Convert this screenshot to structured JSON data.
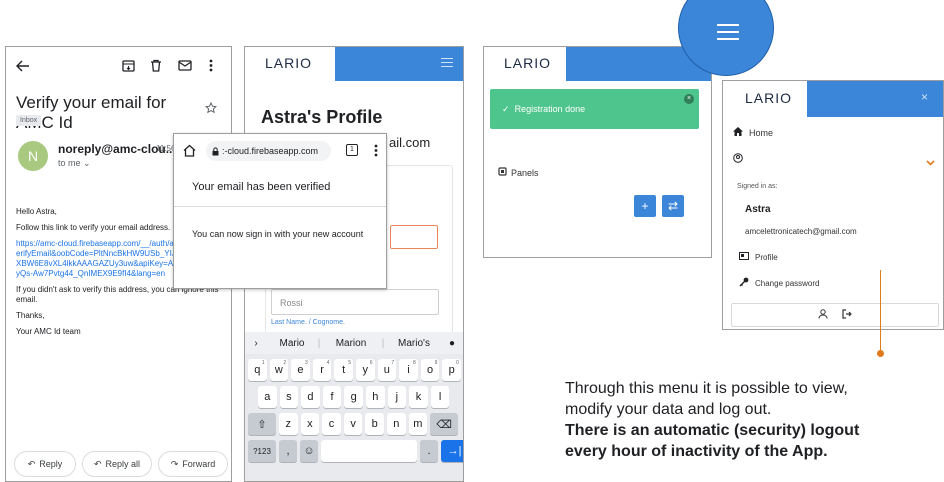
{
  "email": {
    "subject": "Verify your email for AMC Id",
    "label_chip": "Inbox",
    "avatar_letter": "N",
    "sender": "noreply@amc-clou...",
    "time": "11:56",
    "to": "to me",
    "greeting": "Hello Astra,",
    "line1": "Follow this link to verify your email address.",
    "link": "https://amc-cloud.firebaseapp.com/__/auth/action?mode=verifyEmail&oobCode=PltNncBkHW9USb_YIJ1S8s5YTVWj_XBW6E8vXL4lkkAAAGAZUy3uw&apiKey=AIzaSyBjpgh0QyQs-Aw7Pvtg44_QnIMEX9E9fI4&lang=en",
    "line2": "If you didn't ask to verify this address, you can ignore this email.",
    "thanks": "Thanks,",
    "signature": "Your AMC Id team",
    "reply_label": "Reply",
    "reply_all_label": "Reply all",
    "forward_label": "Forward"
  },
  "verified_popup": {
    "url": ":-cloud.firebaseapp.com",
    "tab_count": "1",
    "title": "Your email has been verified",
    "message": "You can now sign in with your new account"
  },
  "profile": {
    "logo": "LARIO",
    "title": "Astra's Profile",
    "email_partial": "ail.com",
    "lastname_value": "Rossi",
    "lastname_label": "Last Name. / Cognome."
  },
  "keyboard": {
    "suggestions": [
      "Mario",
      "Marion",
      "Mario's"
    ],
    "row1": [
      "q",
      "w",
      "e",
      "r",
      "t",
      "y",
      "u",
      "i",
      "o",
      "p"
    ],
    "row1_nums": [
      "1",
      "2",
      "3",
      "4",
      "5",
      "6",
      "7",
      "8",
      "9",
      "0"
    ],
    "row2": [
      "a",
      "s",
      "d",
      "f",
      "g",
      "h",
      "j",
      "k",
      "l"
    ],
    "row3": [
      "z",
      "x",
      "c",
      "v",
      "b",
      "n",
      "m"
    ],
    "sym_key": "?123",
    "comma": ",",
    "period": "."
  },
  "registration": {
    "logo": "LARIO",
    "toast": "Registration done",
    "panels_label": "Panels",
    "add_btn": "+",
    "swap_btn": "⇄"
  },
  "side_menu": {
    "logo": "LARIO",
    "close": "×",
    "home": "Home",
    "signed_in_as": "Signed in as:",
    "user_name": "Astra",
    "user_email": "amcelettronicatech@gmail.com",
    "profile": "Profile",
    "change_password": "Change password"
  },
  "caption": {
    "line1": "Through this menu it is possible to view,",
    "line2": "modify your data and log out.",
    "bold1": "There is an automatic (security) logout",
    "bold2": "every hour of inactivity of the App."
  },
  "colors": {
    "brand_blue": "#3b86d9",
    "toast_green": "#4fc58e",
    "accent_orange": "#e07b1d"
  }
}
